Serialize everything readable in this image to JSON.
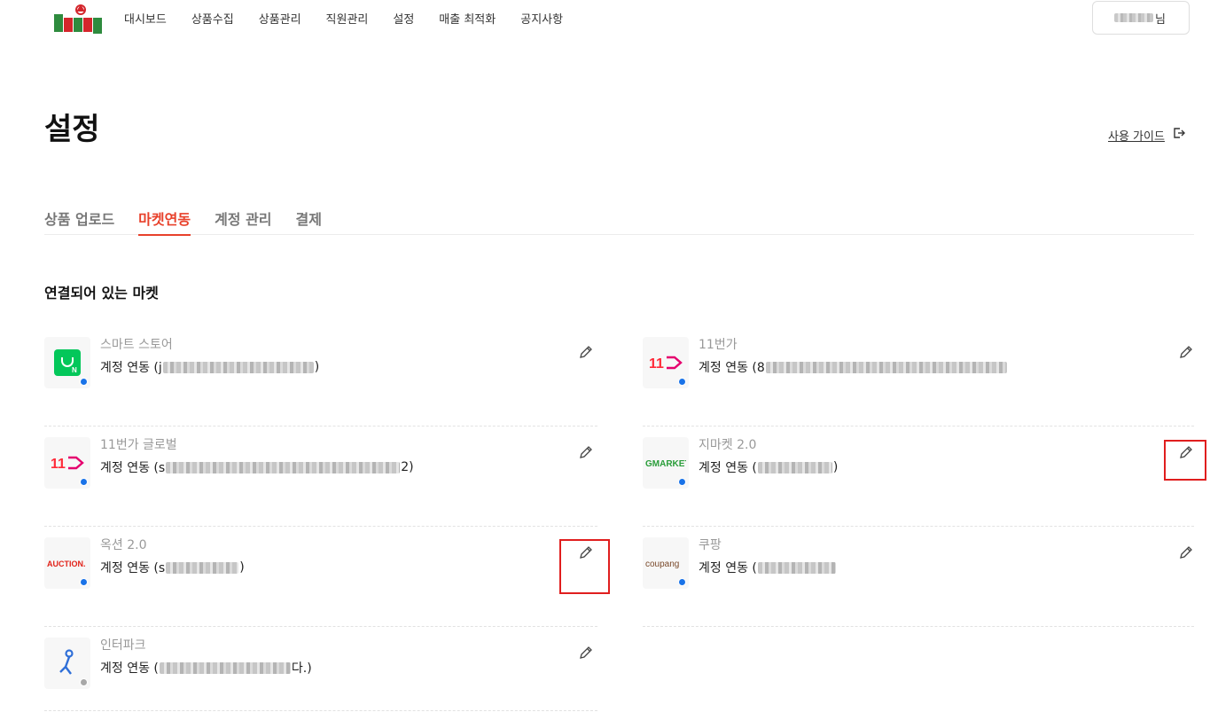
{
  "nav": {
    "links": [
      "대시보드",
      "상품수집",
      "상품관리",
      "직원관리",
      "설정",
      "매출 최적화",
      "공지사항"
    ],
    "user_suffix": "님"
  },
  "header": {
    "title": "설정",
    "guide_label": "사용 가이드"
  },
  "tabs": [
    "상품 업로드",
    "마켓연동",
    "계정 관리",
    "결제"
  ],
  "active_tab": "마켓연동",
  "section_title": "연결되어 있는 마켓",
  "markets": [
    {
      "name": "스마트 스토어",
      "status_prefix": "계정 연동 (j",
      "status_suffix": ")",
      "logo": "naver-smartstore-icon",
      "connected": true
    },
    {
      "name": "11번가",
      "status_prefix": "계정 연동 (8",
      "status_suffix": "",
      "logo": "11st-icon",
      "connected": true
    },
    {
      "name": "11번가 글로벌",
      "status_prefix": "계정 연동 (s",
      "status_suffix": "2)",
      "logo": "11st-icon",
      "connected": true
    },
    {
      "name": "지마켓 2.0",
      "status_prefix": "계정 연동 (",
      "status_suffix": ")",
      "logo": "gmarket-icon",
      "connected": true
    },
    {
      "name": "옥션 2.0",
      "status_prefix": "계정 연동 (s",
      "status_suffix": ")",
      "logo": "auction-icon",
      "connected": true
    },
    {
      "name": "쿠팡",
      "status_prefix": "계정 연동 (",
      "status_suffix": "",
      "logo": "coupang-icon",
      "connected": true
    },
    {
      "name": "인터파크",
      "status_prefix": "계정 연동 (",
      "status_suffix": "다.)",
      "logo": "interpark-icon",
      "connected": false
    }
  ],
  "logo_texts": {
    "eleven": "11",
    "gmarket": "GMARKET",
    "auction": "AUCTION.",
    "coupang": "coupang"
  },
  "colors": {
    "accent": "#e8412b",
    "connected_dot": "#1a73e8",
    "disconnected_dot": "#a8a8a8",
    "highlight_box": "#e01e1e"
  }
}
